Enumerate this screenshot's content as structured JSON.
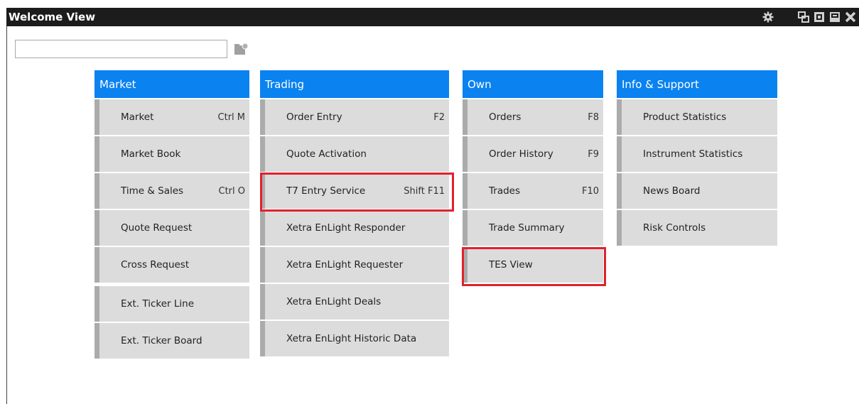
{
  "window": {
    "title": "Welcome View",
    "icons": [
      "gear-icon",
      "restore-icon",
      "maximize-icon",
      "minimize-icon",
      "close-icon"
    ]
  },
  "search": {
    "value": "",
    "placeholder": "",
    "button_icon": "search-folder-icon"
  },
  "colors": {
    "header_blue": "#0a82f0",
    "item_bg": "#dcdcdc",
    "item_stripe": "#ababab",
    "highlight": "#e0222c",
    "titlebar": "#1c1c1c"
  },
  "columns": [
    {
      "title": "Market",
      "items": [
        {
          "label": "Market",
          "shortcut": "Ctrl M"
        },
        {
          "label": "Market Book",
          "shortcut": ""
        },
        {
          "label": "Time & Sales",
          "shortcut": "Ctrl O"
        },
        {
          "label": "Quote Request",
          "shortcut": ""
        },
        {
          "label": "Cross Request",
          "shortcut": ""
        },
        {
          "label": "Ext. Ticker Line",
          "shortcut": ""
        },
        {
          "label": "Ext. Ticker Board",
          "shortcut": ""
        }
      ]
    },
    {
      "title": "Trading",
      "items": [
        {
          "label": "Order Entry",
          "shortcut": "F2"
        },
        {
          "label": "Quote Activation",
          "shortcut": ""
        },
        {
          "label": "T7 Entry Service",
          "shortcut": "Shift F11"
        },
        {
          "label": "Xetra EnLight Responder",
          "shortcut": ""
        },
        {
          "label": "Xetra EnLight Requester",
          "shortcut": ""
        },
        {
          "label": "Xetra EnLight Deals",
          "shortcut": ""
        },
        {
          "label": "Xetra EnLight Historic Data",
          "shortcut": ""
        }
      ]
    },
    {
      "title": "Own",
      "items": [
        {
          "label": "Orders",
          "shortcut": "F8"
        },
        {
          "label": "Order History",
          "shortcut": "F9"
        },
        {
          "label": "Trades",
          "shortcut": "F10"
        },
        {
          "label": "Trade Summary",
          "shortcut": ""
        },
        {
          "label": "TES View",
          "shortcut": ""
        }
      ]
    },
    {
      "title": "Info & Support",
      "items": [
        {
          "label": "Product Statistics",
          "shortcut": ""
        },
        {
          "label": "Instrument Statistics",
          "shortcut": ""
        },
        {
          "label": "News Board",
          "shortcut": ""
        },
        {
          "label": "Risk Controls",
          "shortcut": ""
        }
      ]
    }
  ]
}
